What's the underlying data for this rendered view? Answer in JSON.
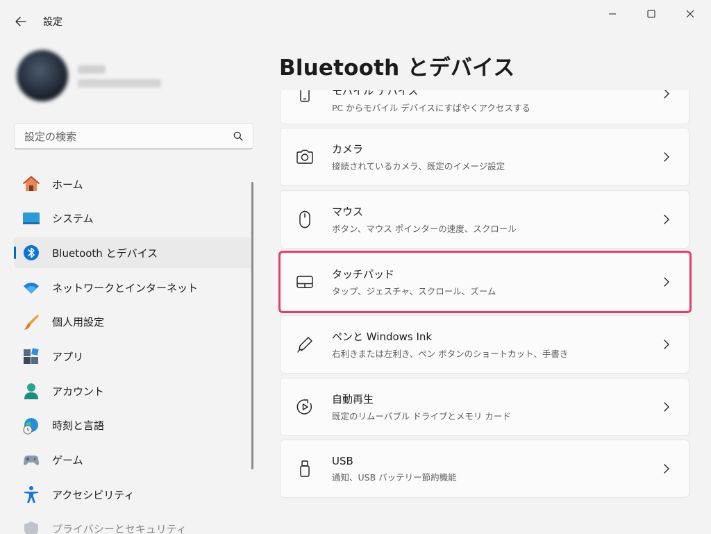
{
  "window": {
    "app_title": "設定",
    "back": "back-arrow-icon",
    "controls": [
      "minimize-icon",
      "maximize-icon",
      "close-icon"
    ]
  },
  "search": {
    "placeholder": "設定の検索",
    "icon": "search-icon"
  },
  "nav": {
    "items": [
      {
        "label": "ホーム",
        "icon": "home-icon",
        "selected": false
      },
      {
        "label": "システム",
        "icon": "system-icon",
        "selected": false
      },
      {
        "label": "Bluetooth とデバイス",
        "icon": "bluetooth-icon",
        "selected": true
      },
      {
        "label": "ネットワークとインターネット",
        "icon": "wifi-icon",
        "selected": false
      },
      {
        "label": "個人用設定",
        "icon": "brush-icon",
        "selected": false
      },
      {
        "label": "アプリ",
        "icon": "apps-icon",
        "selected": false
      },
      {
        "label": "アカウント",
        "icon": "account-icon",
        "selected": false
      },
      {
        "label": "時刻と言語",
        "icon": "globe-clock-icon",
        "selected": false
      },
      {
        "label": "ゲーム",
        "icon": "gamepad-icon",
        "selected": false
      },
      {
        "label": "アクセシビリティ",
        "icon": "accessibility-icon",
        "selected": false
      },
      {
        "label": "プライバシーとセキュリティ",
        "icon": "shield-icon",
        "selected": false
      }
    ]
  },
  "page": {
    "title": "Bluetooth とデバイス"
  },
  "cards": [
    {
      "title": "モバイル デバイス",
      "subtitle": "PC からモバイル デバイスにすばやくアクセスする",
      "icon": "phone-icon"
    },
    {
      "title": "カメラ",
      "subtitle": "接続されているカメラ、既定のイメージ設定",
      "icon": "camera-icon"
    },
    {
      "title": "マウス",
      "subtitle": "ボタン、マウス ポインターの速度、スクロール",
      "icon": "mouse-icon"
    },
    {
      "title": "タッチパッド",
      "subtitle": "タップ、ジェスチャ、スクロール、ズーム",
      "icon": "touchpad-icon",
      "highlighted": true
    },
    {
      "title": "ペンと Windows Ink",
      "subtitle": "右利きまたは左利き、ペン ボタンのショートカット、手書き",
      "icon": "pen-icon"
    },
    {
      "title": "自動再生",
      "subtitle": "既定のリムーバブル ドライブとメモリ カード",
      "icon": "autoplay-icon"
    },
    {
      "title": "USB",
      "subtitle": "通知、USB バッテリー節約機能",
      "icon": "usb-icon"
    }
  ],
  "colors": {
    "accent": "#0067c0",
    "highlight_border": "#e0426e",
    "background": "#f3f3f3",
    "card": "#fbfbfb"
  }
}
